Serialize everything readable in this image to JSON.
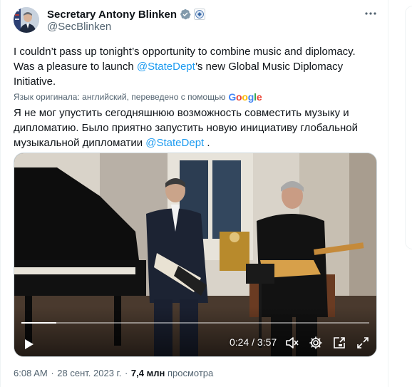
{
  "author": {
    "display_name": "Secretary Antony Blinken",
    "handle": "@SecBlinken",
    "verified_color": "#829aab"
  },
  "tweet": {
    "text_part1": "I couldn’t pass up tonight’s opportunity to combine music and diplomacy. Was a pleasure to launch ",
    "mention": "@StateDept",
    "text_part2": "’s new Global Music Diplomacy Initiative.",
    "translation_note": "Язык оригинала: английский, переведено с помощью",
    "translation_provider": "Google",
    "translated_part1": "Я не мог упустить сегодняшнюю возможность совместить музыку и дипломатию. Было приятно запустить новую инициативу глобальной музыкальной дипломатии ",
    "translated_mention": "@StateDept",
    "translated_part2": " ."
  },
  "video": {
    "time_display": "0:24 / 3:57",
    "progress_fraction": 0.1
  },
  "meta": {
    "time": "6:08 AM",
    "separator": "·",
    "date": "28 сент. 2023 г.",
    "views_count": "7,4 млн",
    "views_label": "просмотра"
  },
  "icons": {
    "more": "more-dots-icon",
    "verified": "verified-badge-icon",
    "gov": "government-affiliate-icon",
    "play": "play-icon",
    "mute": "volume-muted-icon",
    "settings": "settings-gear-icon",
    "pip": "picture-in-picture-icon",
    "fullscreen": "fullscreen-icon"
  },
  "colors": {
    "link": "#1d9bf0",
    "secondary_text": "#536471"
  }
}
